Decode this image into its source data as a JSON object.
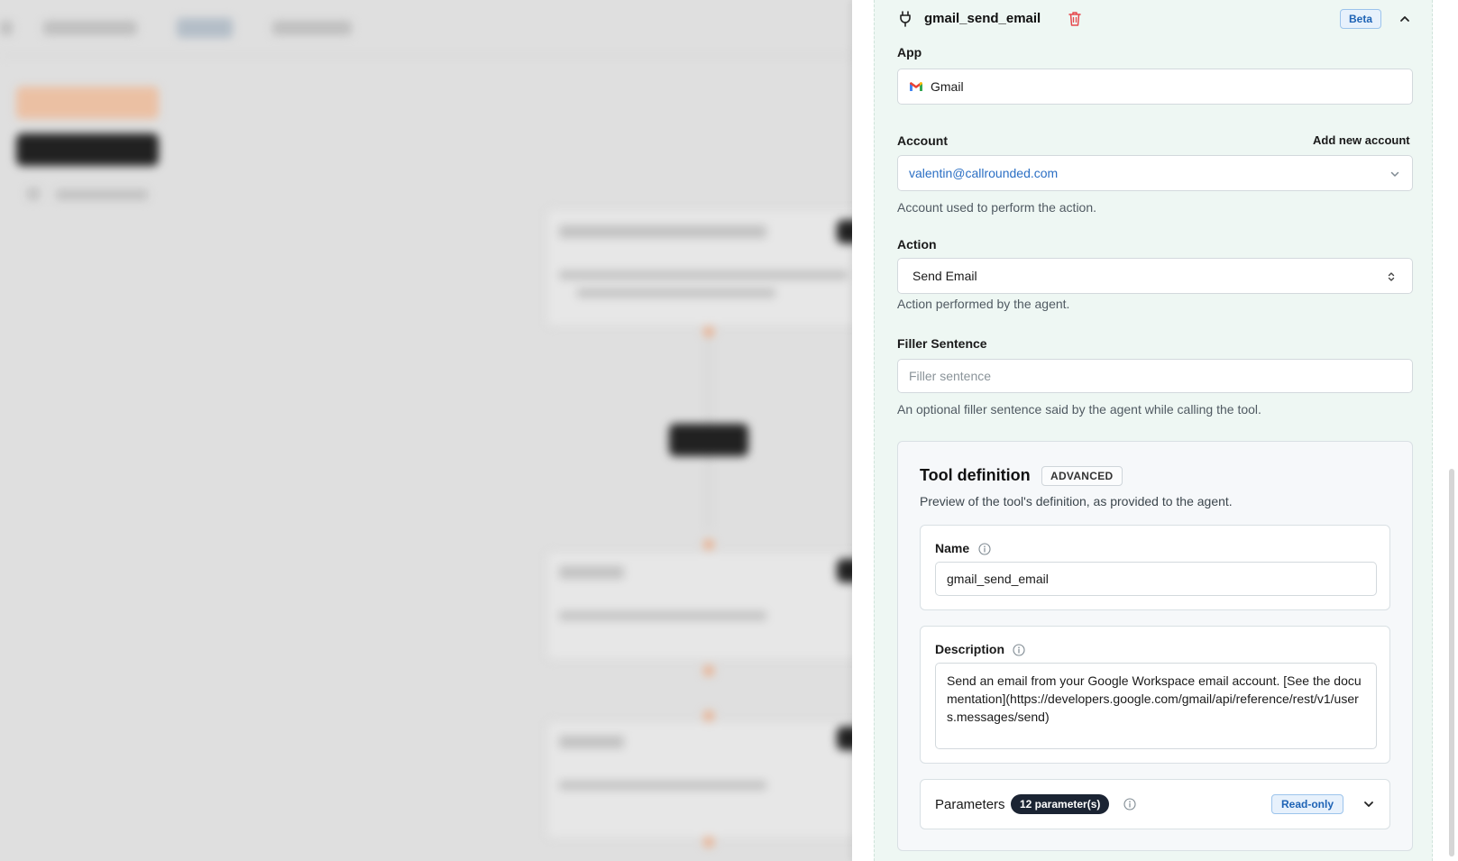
{
  "tool": {
    "name": "gmail_send_email",
    "badge": "Beta"
  },
  "app": {
    "label": "App",
    "value": "Gmail"
  },
  "account": {
    "label": "Account",
    "add_label": "Add new account",
    "value": "valentin@callrounded.com",
    "help": "Account used to perform the action."
  },
  "action": {
    "label": "Action",
    "value": "Send Email",
    "help": "Action performed by the agent."
  },
  "filler": {
    "label": "Filler Sentence",
    "placeholder": "Filler sentence",
    "help": "An optional filler sentence said by the agent while calling the tool."
  },
  "tool_definition": {
    "title": "Tool definition",
    "badge": "ADVANCED",
    "subtitle": "Preview of the tool's definition, as provided to the agent.",
    "name_label": "Name",
    "name_value": "gmail_send_email",
    "description_label": "Description",
    "description_value": "Send an email from your Google Workspace email account. [See the documentation](https://developers.google.com/gmail/api/reference/rest/v1/users.messages/send)",
    "parameters_label": "Parameters",
    "parameters_count": "12 parameter(s)",
    "parameters_badge": "Read-only"
  },
  "colors": {
    "panel_bg": "#eef7f3",
    "link_blue": "#2b6fc4",
    "trash_red": "#e5484d",
    "badge_blue_bg": "#e7f1fc",
    "param_badge_bg": "#1b2433"
  },
  "icons": {
    "plug": "plug-icon",
    "trash": "trash-icon",
    "collapse": "chevron-up-icon",
    "gmail": "gmail-logo-icon",
    "select": "chevron-down-icon",
    "updown": "chevron-updown-icon",
    "info": "info-icon",
    "expand": "chevron-down-icon"
  }
}
